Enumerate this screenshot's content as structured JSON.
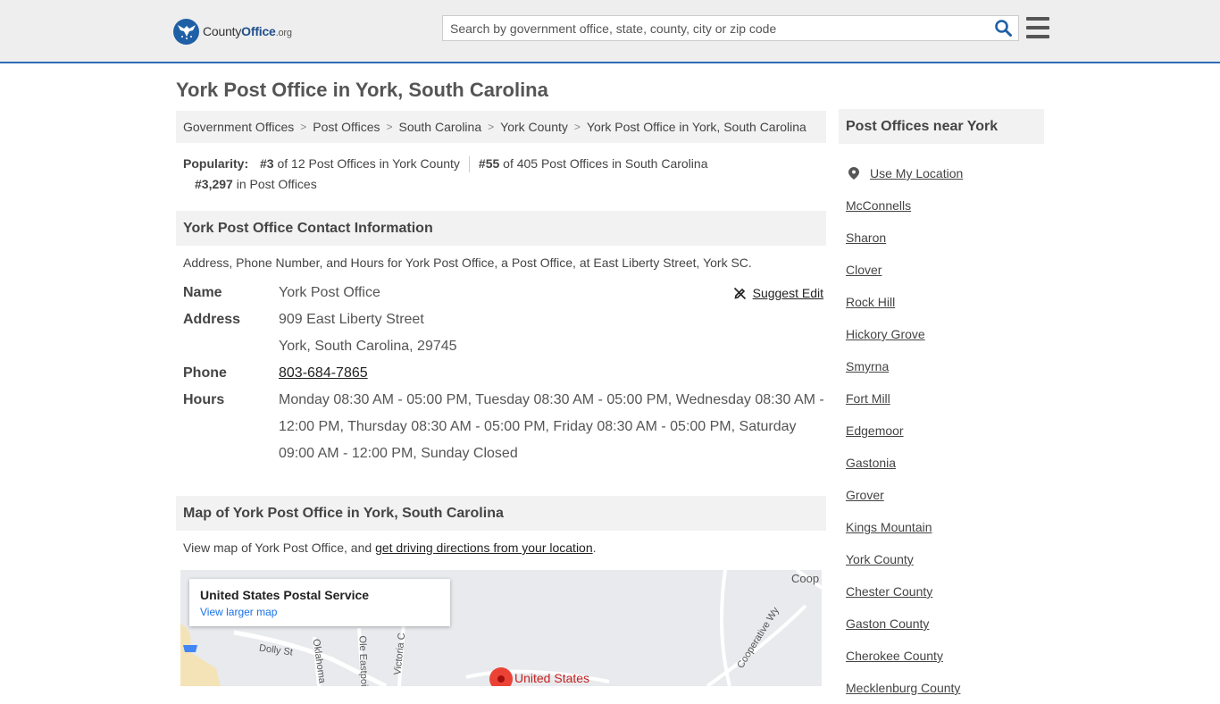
{
  "header": {
    "logo_brand": "County",
    "logo_brand2": "Office",
    "logo_tld": ".org",
    "search_placeholder": "Search by government office, state, county, city or zip code"
  },
  "page": {
    "title": "York Post Office in York, South Carolina"
  },
  "breadcrumb": [
    "Government Offices",
    "Post Offices",
    "South Carolina",
    "York County",
    "York Post Office in York, South Carolina"
  ],
  "popularity": {
    "label": "Popularity:",
    "items": [
      {
        "rank": "#3",
        "text": "of 12 Post Offices in York County"
      },
      {
        "rank": "#55",
        "text": "of 405 Post Offices in South Carolina"
      },
      {
        "rank": "#3,297",
        "text": "in Post Offices"
      }
    ]
  },
  "contact": {
    "heading": "York Post Office Contact Information",
    "description": "Address, Phone Number, and Hours for York Post Office, a Post Office, at East Liberty Street, York SC.",
    "suggest_edit": "Suggest Edit",
    "name_label": "Name",
    "name": "York Post Office",
    "address_label": "Address",
    "address_line1": "909 East Liberty Street",
    "address_line2": "York, South Carolina, 29745",
    "phone_label": "Phone",
    "phone": "803-684-7865",
    "hours_label": "Hours",
    "hours": "Monday 08:30 AM - 05:00 PM, Tuesday 08:30 AM - 05:00 PM, Wednesday 08:30 AM - 12:00 PM, Thursday 08:30 AM - 05:00 PM, Friday 08:30 AM - 05:00 PM, Saturday 09:00 AM - 12:00 PM, Sunday Closed"
  },
  "map": {
    "heading": "Map of York Post Office in York, South Carolina",
    "desc_prefix": "View map of York Post Office, and ",
    "desc_link": "get driving directions from your location",
    "desc_suffix": ".",
    "card_title": "United States Postal Service",
    "card_link": "View larger map",
    "labels": {
      "dolly": "Dolly St",
      "oklahoma": "Oklahoma",
      "eastpoint": "Ole Eastpoi",
      "victoria": "Victoria C",
      "cooperative": "Cooperative Wy",
      "coop": "Coop",
      "pin": "United States"
    },
    "colors": {
      "pin": "#ea4335",
      "land": "#e8eaed",
      "road": "#ffffff",
      "sand": "#f5e3b8"
    }
  },
  "sidebar": {
    "heading": "Post Offices near York",
    "use_location": "Use My Location",
    "items": [
      "McConnells",
      "Sharon",
      "Clover",
      "Rock Hill",
      "Hickory Grove",
      "Smyrna",
      "Fort Mill",
      "Edgemoor",
      "Gastonia",
      "Grover",
      "Kings Mountain",
      "York County",
      "Chester County",
      "Gaston County",
      "Cherokee County",
      "Mecklenburg County"
    ]
  },
  "colors": {
    "accent": "#2d6db5",
    "search_icon": "#1f5fa6",
    "header_bg": "#eeeeee",
    "section_bg": "#f2f2f2"
  }
}
